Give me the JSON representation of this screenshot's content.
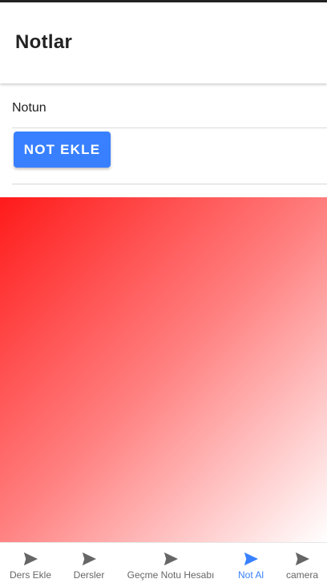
{
  "header": {
    "title": "Notlar"
  },
  "form": {
    "input_placeholder": "Notun",
    "add_button_label": "NOT EKLE"
  },
  "colors": {
    "accent": "#3880ff",
    "gradient_start": "#ff1a1a",
    "gradient_end": "#ffffff"
  },
  "tabs": [
    {
      "label": "Ders Ekle",
      "icon": "send-icon",
      "active": false
    },
    {
      "label": "Dersler",
      "icon": "send-icon",
      "active": false
    },
    {
      "label": "Geçme Notu Hesabı",
      "icon": "send-icon",
      "active": false
    },
    {
      "label": "Not Al",
      "icon": "send-icon",
      "active": true
    },
    {
      "label": "camera",
      "icon": "send-icon",
      "active": false
    }
  ]
}
